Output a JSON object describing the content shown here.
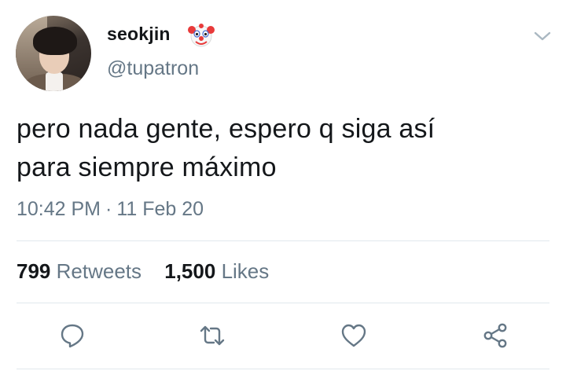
{
  "author": {
    "display_name": "seokjin",
    "badge_emoji": "clown-face",
    "handle": "@tupatron"
  },
  "tweet": {
    "text_line1": "pero nada gente, espero q siga así",
    "text_line2": "para siempre máximo",
    "time": "10:42 PM",
    "separator": "·",
    "date": "11 Feb 20"
  },
  "stats": {
    "retweets_count": "799",
    "retweets_label": "Retweets",
    "likes_count": "1,500",
    "likes_label": "Likes"
  },
  "actions": {
    "icons": [
      "reply-icon",
      "retweet-icon",
      "like-icon",
      "share-icon"
    ]
  },
  "colors": {
    "text_primary": "#14171a",
    "text_secondary": "#657786",
    "divider": "#e1e8ed",
    "icon": "#657786"
  }
}
